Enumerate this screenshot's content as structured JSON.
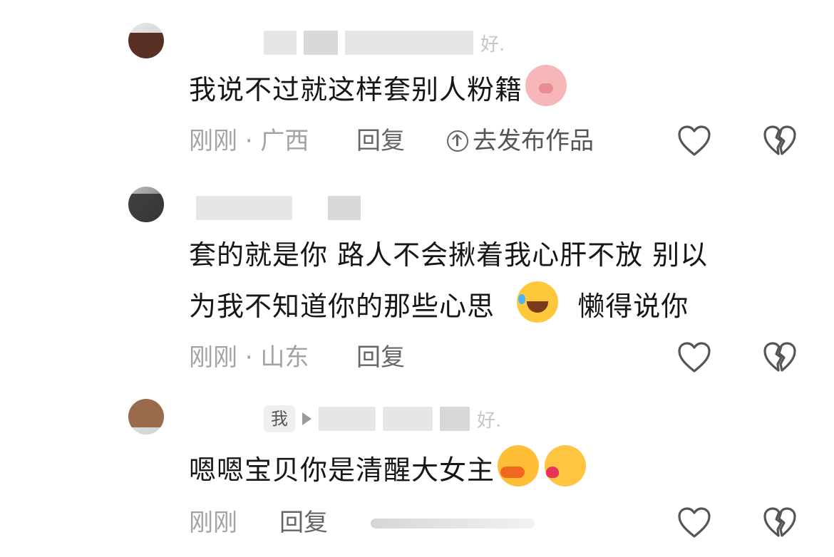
{
  "comments": [
    {
      "name_tail": "好.",
      "text": "我说不过就这样套别人粉籍",
      "emoji_1": "pig-face-emoji",
      "time_location": "刚刚 · 广西",
      "reply_label": "回复",
      "publish_label": "去发布作品",
      "avatar_color": "#5a2f24"
    },
    {
      "text_line_1": "套的就是你 路人不会揪着我心肝不放 别以",
      "text_line_2_a": "为我不知道你的那些心思",
      "text_line_2_b": "懒得说你",
      "emoji_1": "laughing-tears-emoji",
      "time_location": "刚刚 · 山东",
      "reply_label": "回复",
      "avatar_color": "#2c2c2c"
    },
    {
      "me_badge": "我",
      "name_tail": "好.",
      "text": "嗯嗯宝贝你是清醒大女主",
      "emoji_1": "smug-duck-face-emoji",
      "emoji_2": "kissing-face-emoji",
      "time_location": "刚刚",
      "reply_label": "回复",
      "avatar_color": "#9a6a4c"
    }
  ],
  "colors": {
    "text": "#161616",
    "meta": "#a3a3a3",
    "icon": "#555555"
  }
}
